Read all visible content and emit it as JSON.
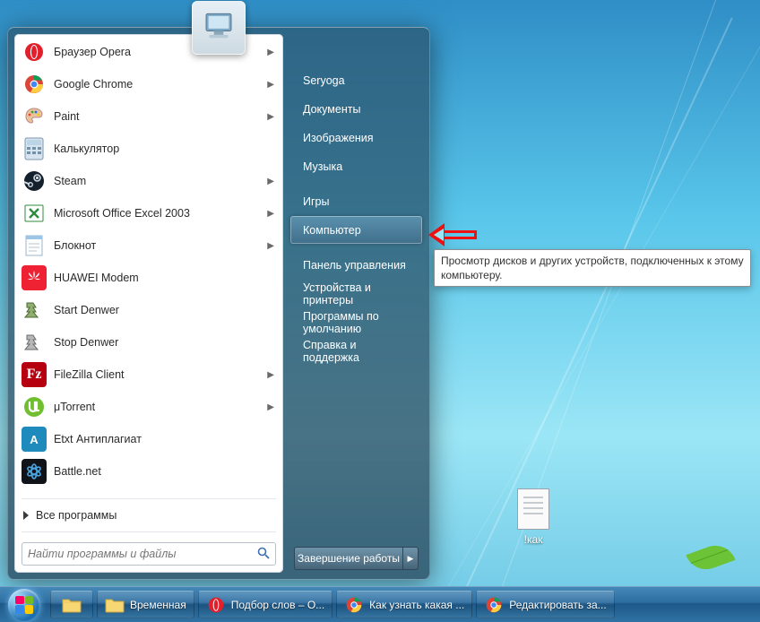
{
  "desktop": {
    "file_name": "!как"
  },
  "start_menu": {
    "programs": [
      {
        "id": "opera",
        "label": "Браузер Opera",
        "submenu": true
      },
      {
        "id": "chrome",
        "label": "Google Chrome",
        "submenu": true
      },
      {
        "id": "paint",
        "label": "Paint",
        "submenu": true
      },
      {
        "id": "calc",
        "label": "Калькулятор",
        "submenu": false
      },
      {
        "id": "steam",
        "label": "Steam",
        "submenu": true
      },
      {
        "id": "excel",
        "label": "Microsoft Office Excel 2003",
        "submenu": true
      },
      {
        "id": "notepad",
        "label": "Блокнот",
        "submenu": true
      },
      {
        "id": "huawei",
        "label": "HUAWEI Modem",
        "submenu": false
      },
      {
        "id": "startden",
        "label": "Start Denwer",
        "submenu": false
      },
      {
        "id": "stopden",
        "label": "Stop Denwer",
        "submenu": false
      },
      {
        "id": "filezilla",
        "label": "FileZilla Client",
        "submenu": true
      },
      {
        "id": "utorrent",
        "label": "μTorrent",
        "submenu": true
      },
      {
        "id": "etxt",
        "label": "Etxt Антиплагиат",
        "submenu": false
      },
      {
        "id": "battlenet",
        "label": "Battle.net",
        "submenu": false
      }
    ],
    "all_programs_label": "Все программы",
    "search_placeholder": "Найти программы и файлы",
    "right_links": {
      "user": "Seryoga",
      "documents": "Документы",
      "pictures": "Изображения",
      "music": "Музыка",
      "games": "Игры",
      "computer": "Компьютер",
      "control": "Панель управления",
      "devices": "Устройства и принтеры",
      "defaults": "Программы по умолчанию",
      "help": "Справка и поддержка"
    },
    "shutdown_label": "Завершение работы"
  },
  "tooltip": {
    "text": "Просмотр дисков и других устройств, подключенных к этому компьютеру."
  },
  "taskbar": {
    "items": [
      {
        "id": "explorer-pin",
        "label": "",
        "kind": "icononly"
      },
      {
        "id": "folder-temp",
        "label": "Временная",
        "kind": "normal"
      },
      {
        "id": "opera-task",
        "label": "Подбор слов – O...",
        "kind": "normal"
      },
      {
        "id": "chrome-task1",
        "label": "Как узнать какая ...",
        "kind": "normal"
      },
      {
        "id": "chrome-task2",
        "label": "Редактировать за...",
        "kind": "normal"
      }
    ]
  }
}
